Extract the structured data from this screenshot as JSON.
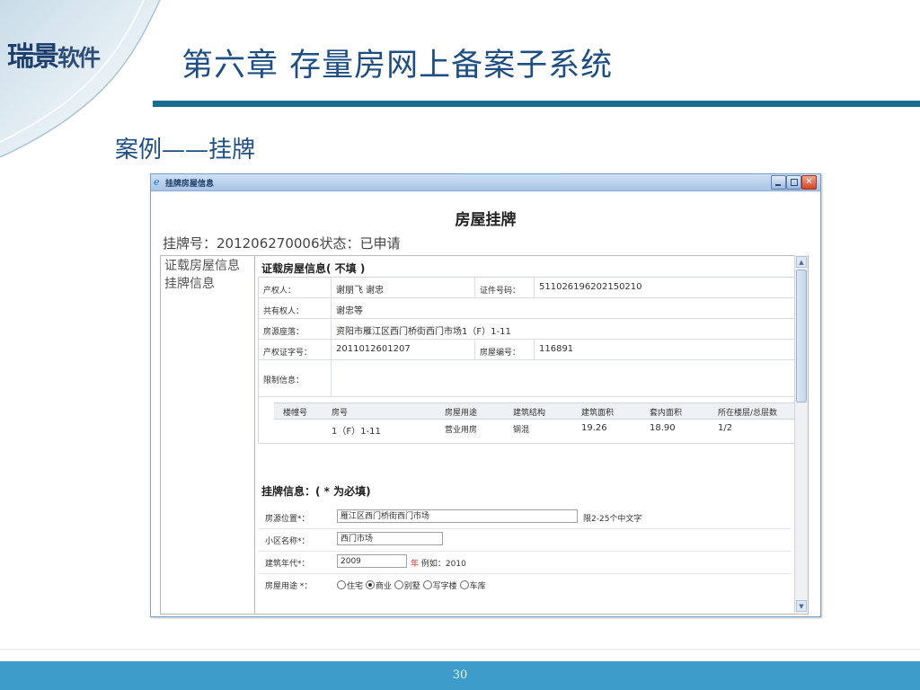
{
  "brand": {
    "logo_main": "瑞景",
    "logo_rest": "软件"
  },
  "slide": {
    "title": "第六章  存量房网上备案子系统",
    "subtitle": "案例——挂牌",
    "page_number": "30"
  },
  "window": {
    "title": "挂牌房屋信息",
    "heading": "房屋挂牌",
    "reg_line": "挂牌号：201206270006状态：已申请",
    "nav": [
      "证载房屋信息",
      "挂牌信息"
    ],
    "cert_section": {
      "title": "证载房屋信息( 不填 )",
      "owner_label": "产权人：",
      "owner": "谢朋飞 谢忠",
      "id_label": "证件号码：",
      "id_no": "511026196202150210",
      "co_owner_label": "共有权人：",
      "co_owner": "谢忠等",
      "location_label": "房源座落：",
      "location": "资阳市雁江区西门桥街西门市场1（F）1-11",
      "cert_no_label": "产权证字号：",
      "cert_no": "2011012601207",
      "house_no_label": "房屋编号：",
      "house_no": "116891",
      "limit_label": "限制信息："
    },
    "house_table": {
      "headers": [
        "楼幢号",
        "房号",
        "房屋用途",
        "建筑结构",
        "建筑面积",
        "套内面积",
        "所在楼层/总层数"
      ],
      "rows": [
        [
          "",
          "1（F）1-11",
          "营业用房",
          "钢混",
          "19.26",
          "18.90",
          "1/2"
        ]
      ]
    },
    "listing_section": {
      "title": "挂牌信息：( * 为必填)",
      "location_label": "房源位置*：",
      "location_value": "雁江区西门桥街西门市场",
      "location_hint": "限2-25个中文字",
      "community_label": "小区名称*：",
      "community_value": "西门市场",
      "year_label": "建筑年代*：",
      "year_value": "2009",
      "year_unit": "年",
      "year_hint": "例如：2010",
      "use_label": "房屋用途 *：",
      "use_options": [
        "住宅",
        "商业",
        "别墅",
        "写字楼",
        "车库"
      ],
      "use_selected": "商业"
    }
  }
}
